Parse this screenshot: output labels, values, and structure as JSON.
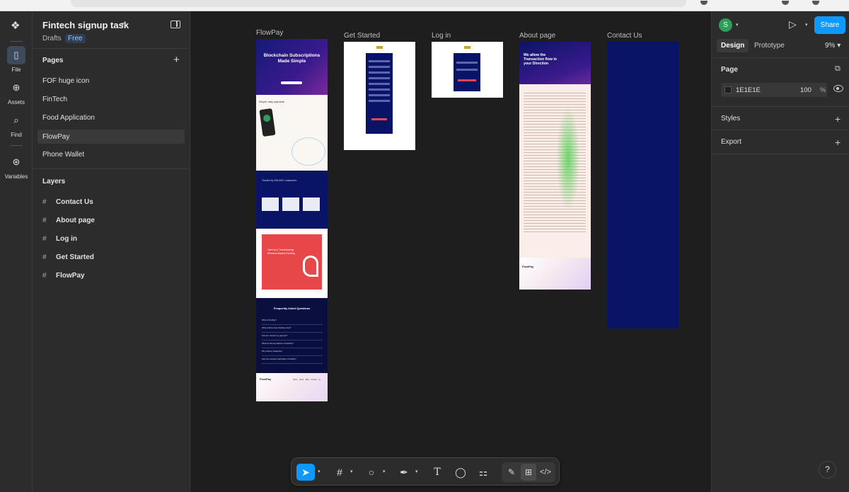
{
  "rail": {
    "items": [
      {
        "label": "File",
        "icon": "file-icon"
      },
      {
        "label": "Assets",
        "icon": "assets-icon"
      },
      {
        "label": "Find",
        "icon": "search-icon"
      },
      {
        "label": "Variables",
        "icon": "variables-icon"
      }
    ]
  },
  "file": {
    "name": "Fintech signup task",
    "location": "Drafts",
    "plan": "Free"
  },
  "pages": {
    "heading": "Pages",
    "items": [
      "FOF huge icon",
      "FinTech",
      "Food Application",
      "FlowPay",
      "Phone Wallet"
    ],
    "selected": "FlowPay"
  },
  "layers": {
    "heading": "Layers",
    "items": [
      "Contact Us",
      "About page",
      "Log in",
      "Get Started",
      "FlowPay"
    ]
  },
  "canvas": {
    "frames": [
      {
        "label": "FlowPay"
      },
      {
        "label": "Get Started"
      },
      {
        "label": "Log in"
      },
      {
        "label": "About page"
      },
      {
        "label": "Contact Us"
      }
    ],
    "flowpay": {
      "hero": "Blockchain Subscriptions Made Simple",
      "section2": "Simple, easy payments",
      "section3": "Trusted by 200,000+ customers",
      "cta": "Join Us in Transforming Revenue-Based Funding",
      "faq_title": "Frequently Asked Questions",
      "faq": [
        "What is FlowPay?",
        "What problem does FlowPay solve?",
        "How do I connect my payment?",
        "What are the key features of FlowPay?",
        "Why build on Avalanche?",
        "How can investors participate in FlowPay?"
      ],
      "footer_logo": "FlowPay",
      "footer_nav": [
        "Home",
        "About",
        "Blog",
        "Contact us"
      ]
    },
    "about": {
      "hero": "We allow the Transaction flow in your Direction",
      "footer_logo": "FlowPay"
    }
  },
  "right": {
    "avatar_initial": "S",
    "share_label": "Share",
    "tabs": [
      "Design",
      "Prototype"
    ],
    "active_tab": "Design",
    "zoom": "9%",
    "page_section": "Page",
    "page_fill_hex": "1E1E1E",
    "page_fill_opacity": "100",
    "page_fill_unit": "%",
    "styles_label": "Styles",
    "export_label": "Export"
  },
  "toolbar": {
    "tools": [
      "move-tool",
      "frame-tool",
      "shape-tool",
      "pen-tool",
      "text-tool",
      "comment-tool",
      "actions-tool",
      "draw-mode",
      "design-mode",
      "dev-mode"
    ]
  },
  "help_label": "?",
  "colors": {
    "accent": "#0d99ff",
    "canvas_bg": "#1e1e1e",
    "panel_bg": "#2c2c2c",
    "navy": "#0a1466",
    "cta_red": "#e8474a"
  }
}
